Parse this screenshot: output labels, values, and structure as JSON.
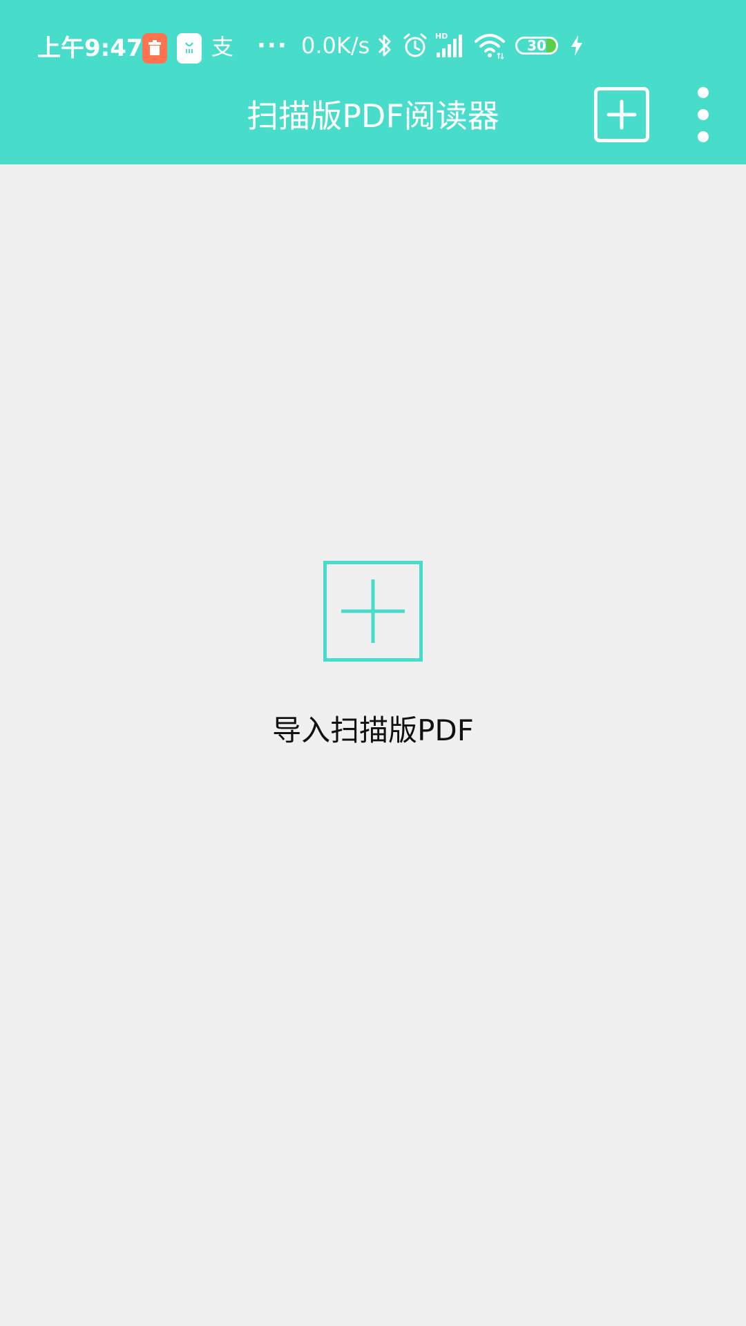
{
  "status_bar": {
    "time": "上午9:47",
    "pay_icon_text": "支",
    "more_text": "···",
    "net_speed": "0.0K/s",
    "signal_label": "HD",
    "battery_level": "30",
    "battery_color": "#5ad04a"
  },
  "toolbar": {
    "title": "扫描版PDF阅读器",
    "background_color": "#48dccb",
    "add_icon": "plus-square-icon",
    "menu_icon": "more-vertical-icon"
  },
  "main": {
    "import_icon": "plus-square-icon",
    "import_label": "导入扫描版PDF",
    "accent_color": "#48dccb"
  }
}
